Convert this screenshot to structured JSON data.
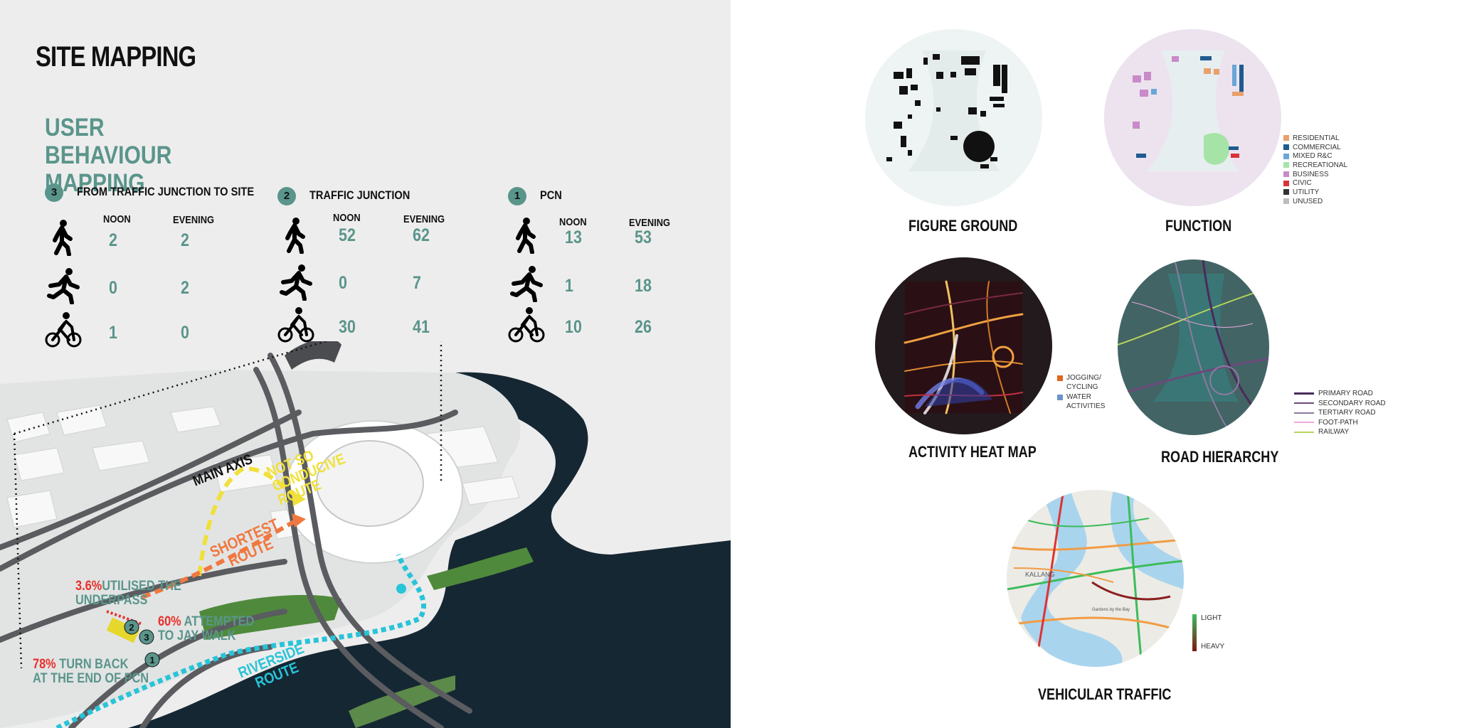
{
  "title": "SITE MAPPING",
  "subtitle_lines": [
    "USER BEHAVIOUR",
    "MAPPING"
  ],
  "columns": [
    {
      "badge": "3",
      "title": "FROM TRAFFIC  JUNCTION TO SITE",
      "noon": "NOON",
      "evening": "EVENING",
      "walk": {
        "noon": "2",
        "evening": "2"
      },
      "run": {
        "noon": "0",
        "evening": "2"
      },
      "cycle": {
        "noon": "1",
        "evening": "0"
      }
    },
    {
      "badge": "2",
      "title": "TRAFFIC JUNCTION",
      "noon": "NOON",
      "evening": "EVENING",
      "walk": {
        "noon": "52",
        "evening": "62"
      },
      "run": {
        "noon": "0",
        "evening": "7"
      },
      "cycle": {
        "noon": "30",
        "evening": "41"
      }
    },
    {
      "badge": "1",
      "title": "PCN",
      "noon": "NOON",
      "evening": "EVENING",
      "walk": {
        "noon": "13",
        "evening": "53"
      },
      "run": {
        "noon": "1",
        "evening": "18"
      },
      "cycle": {
        "noon": "10",
        "evening": "26"
      }
    }
  ],
  "map": {
    "main_axis": "MAIN AXIS",
    "not_conducive_lines": [
      "NOT SO",
      "CONDUCIVE",
      "ROUTE"
    ],
    "shortest_lines": [
      "SHORTEST",
      "ROUTE"
    ],
    "underpass": {
      "pct": "3.6%",
      "text1": "UTILISED THE",
      "text2": "UNDERPASS"
    },
    "jaywalk": {
      "pct": "60%",
      "text1": "ATTEMPTED",
      "text2": "TO JAY WALK"
    },
    "turnback": {
      "pct": "78%",
      "text1": "TURN BACK",
      "text2": "AT THE END OF PCN"
    },
    "riverside_lines": [
      "RIVERSIDE",
      "ROUTE"
    ],
    "markers": [
      "1",
      "2",
      "3"
    ]
  },
  "figure_ground": {
    "label": "FIGURE GROUND"
  },
  "function": {
    "label": "FUNCTION",
    "legend": [
      {
        "name": "RESIDENTIAL",
        "color": "#e9a06a"
      },
      {
        "name": "COMMERCIAL",
        "color": "#1f5b8f"
      },
      {
        "name": "MIXED R&C",
        "color": "#6aa6d6"
      },
      {
        "name": "RECREATIONAL",
        "color": "#a6e3a6"
      },
      {
        "name": "BUSINESS",
        "color": "#c88ac8"
      },
      {
        "name": "CIVIC",
        "color": "#d6343a"
      },
      {
        "name": "UTILITY",
        "color": "#333333"
      },
      {
        "name": "UNUSED",
        "color": "#bdbdbd"
      }
    ]
  },
  "heat_map": {
    "label": "ACTIVITY HEAT MAP",
    "legend": [
      {
        "name": "JOGGING/ CYCLING",
        "color": "#e0671b"
      },
      {
        "name": "WATER ACTIVITIES",
        "color": "#6a93c9"
      }
    ]
  },
  "road_hierarchy": {
    "label": "ROAD HIERARCHY",
    "legend": [
      {
        "name": "PRIMARY ROAD",
        "color": "#4a2b5c"
      },
      {
        "name": "SECONDARY ROAD",
        "color": "#6b4a7c"
      },
      {
        "name": "TERTIARY ROAD",
        "color": "#8c7aa0"
      },
      {
        "name": "FOOT-PATH",
        "color": "#e8a8e0"
      },
      {
        "name": "RAILWAY",
        "color": "#b8d45a"
      }
    ]
  },
  "vehicular": {
    "label": "VEHICULAR TRAFFIC",
    "legend_light": "LIGHT",
    "legend_heavy": "HEAVY",
    "map_labels": [
      "KALLANG",
      "Gardens by the Bay"
    ]
  },
  "colors": {
    "teal": "#5a958b",
    "red": "#e8312b",
    "yellow": "#f0e03a",
    "orange": "#f07840",
    "cyan": "#28c4d8"
  }
}
